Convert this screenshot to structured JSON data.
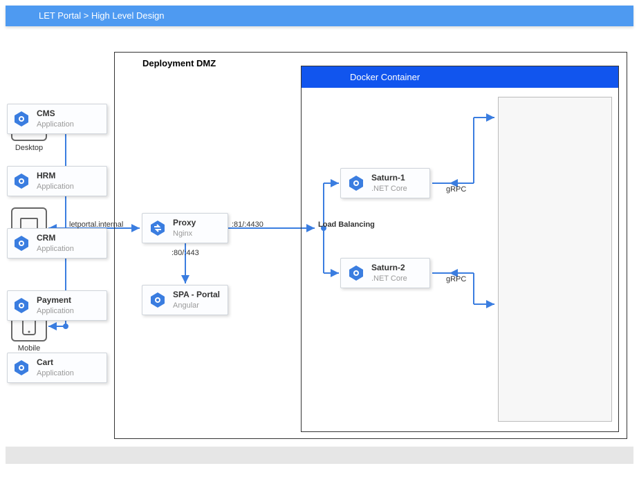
{
  "header": {
    "breadcrumb": "LET Portal > High Level Design"
  },
  "devices": {
    "desktop": "Desktop",
    "laptop": "Laptop",
    "mobile": "Mobile"
  },
  "dmz": {
    "title": "Deployment DMZ"
  },
  "docker": {
    "title": "Docker Container"
  },
  "nodes": {
    "proxy": {
      "title": "Proxy",
      "sub": "Nginx"
    },
    "spa": {
      "title": "SPA - Portal",
      "sub": "Angular"
    },
    "saturn1": {
      "title": "Saturn-1",
      "sub": ".NET Core"
    },
    "saturn2": {
      "title": "Saturn-2",
      "sub": ".NET Core"
    },
    "cms": {
      "title": "CMS",
      "sub": "Application"
    },
    "hrm": {
      "title": "HRM",
      "sub": "Application"
    },
    "crm": {
      "title": "CRM",
      "sub": "Application"
    },
    "payment": {
      "title": "Payment",
      "sub": "Application"
    },
    "cart": {
      "title": "Cart",
      "sub": "Application"
    }
  },
  "labels": {
    "letportal": "letportal.internal",
    "port8180": ":80/:443",
    "port8144": ":81/:4430",
    "loadbal": "Load Balancing",
    "grpc1": "gRPC",
    "grpc2": "gRPC"
  },
  "colors": {
    "blue": "#3a7de0",
    "headerBlue": "#4e9af1",
    "dockerBlue": "#1155ee"
  }
}
